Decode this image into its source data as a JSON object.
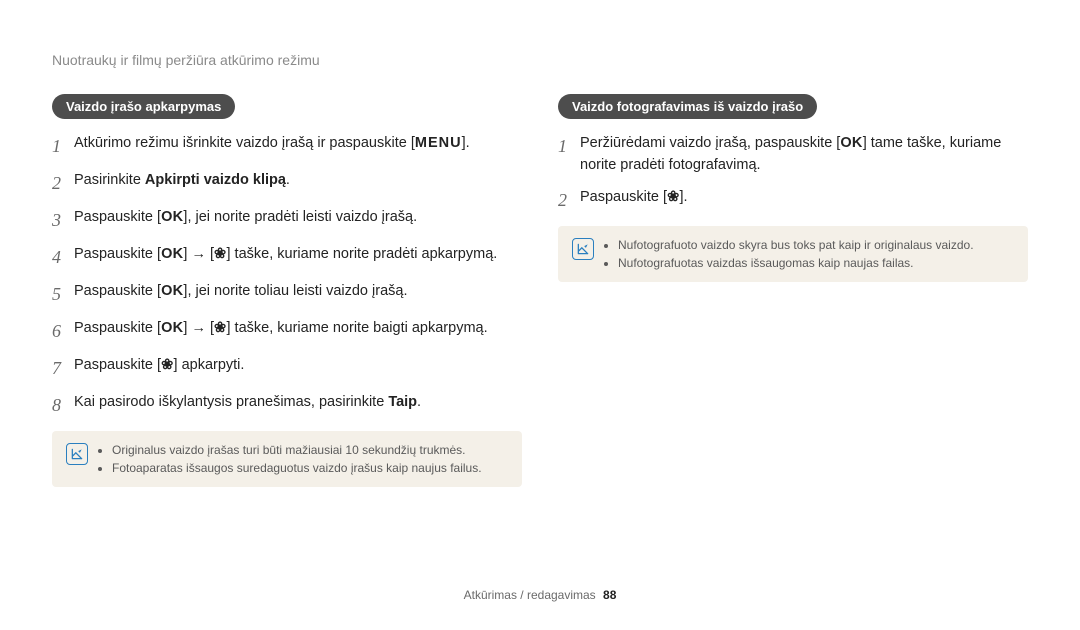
{
  "breadcrumb": "Nuotraukų ir filmų peržiūra atkūrimo režimu",
  "left": {
    "pill": "Vaizdo įrašo apkarpymas",
    "steps": [
      {
        "n": "1",
        "pre": "Atkūrimo režimu išrinkite vaizdo įrašą ir paspauskite [",
        "glyph": "MENU",
        "post": "]."
      },
      {
        "n": "2",
        "pre": "Pasirinkite ",
        "bold": "Apkirpti vaizdo klipą",
        "post2": "."
      },
      {
        "n": "3",
        "pre": "Paspauskite [",
        "glyph": "OK",
        "post": "], jei norite pradėti leisti vaizdo įrašą."
      },
      {
        "n": "4",
        "pre": "Paspauskite [",
        "glyph": "OK",
        "mid": "] → [",
        "glyph2": "flower",
        "post": "] taške, kuriame norite pradėti apkarpymą."
      },
      {
        "n": "5",
        "pre": "Paspauskite [",
        "glyph": "OK",
        "post": "], jei norite toliau leisti vaizdo įrašą."
      },
      {
        "n": "6",
        "pre": "Paspauskite [",
        "glyph": "OK",
        "mid": "] → [",
        "glyph2": "flower",
        "post": "] taške, kuriame norite baigti apkarpymą."
      },
      {
        "n": "7",
        "pre": "Paspauskite [",
        "glyph": "flower",
        "post": "] apkarpyti."
      },
      {
        "n": "8",
        "pre": "Kai pasirodo iškylantysis pranešimas, pasirinkite ",
        "bold": "Taip",
        "post2": "."
      }
    ],
    "note": [
      "Originalus vaizdo įrašas turi būti mažiausiai 10 sekundžių trukmės.",
      "Fotoaparatas išsaugos suredaguotus vaizdo įrašus kaip naujus failus."
    ]
  },
  "right": {
    "pill": "Vaizdo fotografavimas iš vaizdo įrašo",
    "steps": [
      {
        "n": "1",
        "pre": "Peržiūrėdami vaizdo įrašą, paspauskite [",
        "glyph": "OK",
        "post": "] tame taške, kuriame norite pradėti fotografavimą."
      },
      {
        "n": "2",
        "pre": "Paspauskite [",
        "glyph": "flower",
        "post": "]."
      }
    ],
    "note": [
      "Nufotografuoto vaizdo skyra bus toks pat kaip ir originalaus vaizdo.",
      "Nufotografuotas vaizdas išsaugomas kaip naujas failas."
    ]
  },
  "footer": {
    "section": "Atkūrimas / redagavimas",
    "page": "88"
  },
  "glyphs": {
    "MENU": "MENU",
    "OK": "OK",
    "flower": "❀"
  }
}
